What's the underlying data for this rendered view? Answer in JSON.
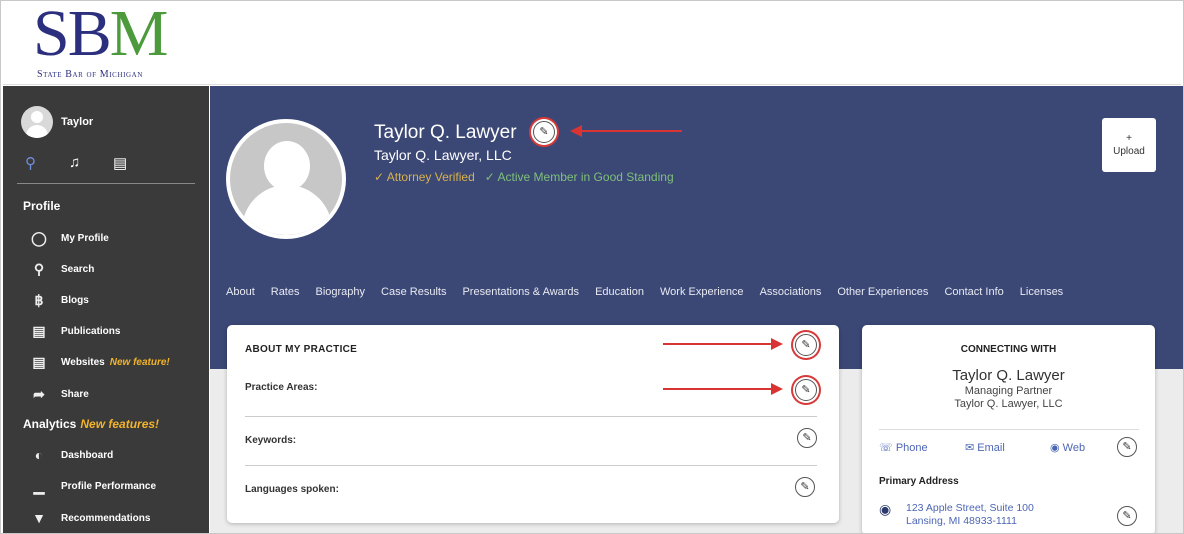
{
  "logo": {
    "letters_s": "S",
    "letters_b": "B",
    "letters_m": "M",
    "tagline": "State Bar of Michigan"
  },
  "sidebar": {
    "user_name": "Taylor",
    "profile_heading": "Profile",
    "items": [
      {
        "label": "My Profile",
        "icon": "user-circle-icon"
      },
      {
        "label": "Search",
        "icon": "search-icon"
      },
      {
        "label": "Blogs",
        "icon": "blog-icon"
      },
      {
        "label": "Publications",
        "icon": "document-icon"
      },
      {
        "label": "Websites",
        "icon": "document-icon",
        "badge": "New feature!"
      },
      {
        "label": "Share",
        "icon": "share-icon"
      }
    ],
    "analytics_heading": "Analytics",
    "analytics_badge": "New features!",
    "analytics_items": [
      {
        "label": "Dashboard",
        "icon": "gauge-icon"
      },
      {
        "label": "Profile Performance",
        "icon": "bar-chart-icon"
      },
      {
        "label": "Recommendations",
        "icon": "award-icon"
      }
    ]
  },
  "banner": {
    "name": "Taylor Q. Lawyer",
    "firm": "Taylor Q. Lawyer, LLC",
    "badge_verified": "Attorney Verified",
    "badge_standing": "Active Member in Good Standing",
    "upload_plus": "+",
    "upload_label": "Upload"
  },
  "tabs": [
    "About",
    "Rates",
    "Biography",
    "Case Results",
    "Presentations & Awards",
    "Education",
    "Work Experience",
    "Associations",
    "Other Experiences",
    "Contact Info",
    "Licenses"
  ],
  "about": {
    "title": "ABOUT MY PRACTICE",
    "practice_areas": "Practice Areas:",
    "keywords": "Keywords:",
    "languages": "Languages spoken:"
  },
  "connecting": {
    "title": "CONNECTING WITH",
    "name": "Taylor Q. Lawyer",
    "role": "Managing Partner",
    "firm": "Taylor Q. Lawyer, LLC",
    "phone": "Phone",
    "email": "Email",
    "web": "Web",
    "address_title": "Primary Address",
    "address_line1": "123 Apple Street, Suite 100",
    "address_line2": "Lansing, MI 48933-1111"
  },
  "colors": {
    "banner": "#3b4775",
    "sidebar": "#3a3a3a",
    "accent_new": "#f1b32b",
    "arrow": "#d83434"
  }
}
